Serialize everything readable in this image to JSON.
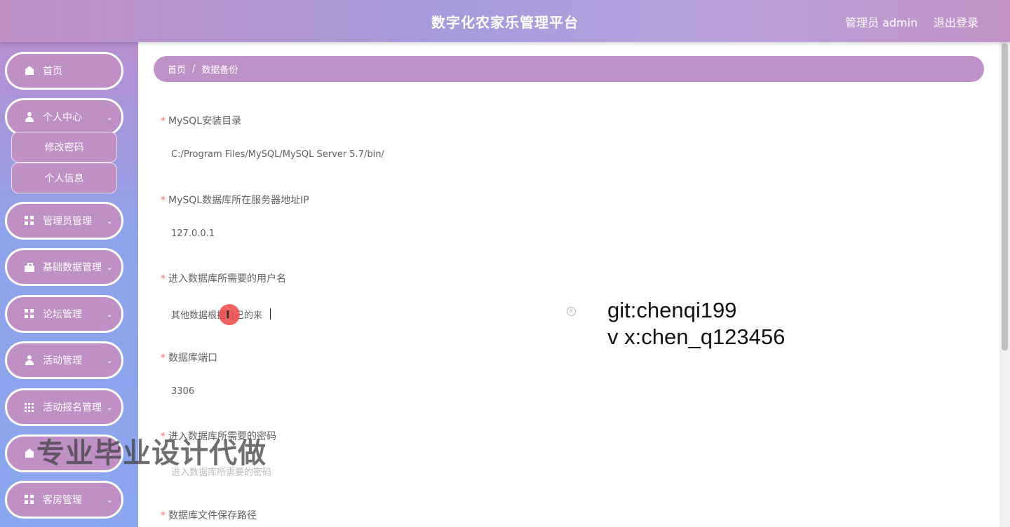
{
  "header": {
    "title": "数字化农家乐管理平台",
    "user": "管理员 admin",
    "logout": "退出登录"
  },
  "sidebar": {
    "items": [
      {
        "label": "首页",
        "icon": "home-icon"
      },
      {
        "label": "个人中心",
        "icon": "user-icon",
        "expanded": true,
        "children": [
          "修改密码",
          "个人信息"
        ]
      },
      {
        "label": "管理员管理",
        "icon": "grid-icon"
      },
      {
        "label": "基础数据管理",
        "icon": "briefcase-icon"
      },
      {
        "label": "论坛管理",
        "icon": "grid-icon"
      },
      {
        "label": "活动管理",
        "icon": "user-icon"
      },
      {
        "label": "活动报名管理",
        "icon": "grid9-icon"
      },
      {
        "label": "",
        "icon": "home-icon"
      },
      {
        "label": "客房管理",
        "icon": "grid-icon"
      }
    ]
  },
  "breadcrumb": {
    "home": "首页",
    "separator": "/",
    "current": "数据备份"
  },
  "form": {
    "fields": [
      {
        "label": "MySQL安装目录",
        "value": "C:/Program Files/MySQL/MySQL Server 5.7/bin/"
      },
      {
        "label": "MySQL数据库所在服务器地址IP",
        "value": "127.0.0.1"
      },
      {
        "label": "进入数据库所需要的用户名",
        "value": "其他数据根据自己的来"
      },
      {
        "label": "数据库端口",
        "value": "3306"
      },
      {
        "label": "进入数据库所需要的密码",
        "value": "",
        "placeholder": "进入数据库所需要的密码"
      },
      {
        "label": "数据库文件保存路径",
        "value": ""
      }
    ]
  },
  "overlay": {
    "git": "git:chenqi199",
    "vx": "v x:chen_q123456",
    "watermark": "专业毕业设计代做"
  },
  "colors": {
    "accent": "#bf8fc6",
    "header_gradient_mid": "#a79bdc",
    "sidebar_bottom": "#8aa6ee",
    "required_star": "#f56c6c"
  }
}
